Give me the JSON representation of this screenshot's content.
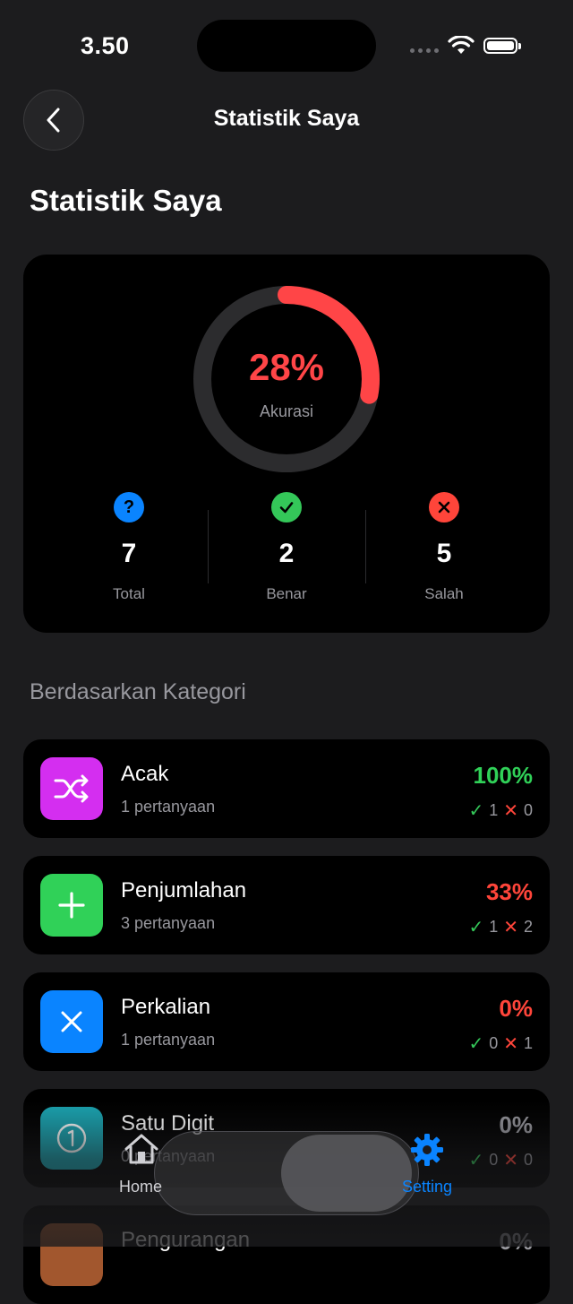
{
  "status_bar": {
    "time": "3.50"
  },
  "nav": {
    "title": "Statistik Saya"
  },
  "page": {
    "title": "Statistik Saya"
  },
  "summary": {
    "accuracy_percent": "28%",
    "accuracy_value": 0.28,
    "accuracy_label": "Akurasi",
    "total": {
      "value": "7",
      "label": "Total",
      "icon": "question-icon",
      "color": "#0a84ff"
    },
    "correct": {
      "value": "2",
      "label": "Benar",
      "icon": "check-icon",
      "color": "#34c759"
    },
    "wrong": {
      "value": "5",
      "label": "Salah",
      "icon": "x-icon",
      "color": "#ff453a"
    }
  },
  "categories_title": "Berdasarkan Kategori",
  "categories": [
    {
      "name": "Acak",
      "count": "1 pertanyaan",
      "percent": "100%",
      "percent_color": "#30d158",
      "correct": "1",
      "wrong": "0",
      "icon": "shuffle-icon",
      "icon_bg": "#d42ef0"
    },
    {
      "name": "Penjumlahan",
      "count": "3 pertanyaan",
      "percent": "33%",
      "percent_color": "#ff453a",
      "correct": "1",
      "wrong": "2",
      "icon": "plus-icon",
      "icon_bg": "#30d158"
    },
    {
      "name": "Perkalian",
      "count": "1 pertanyaan",
      "percent": "0%",
      "percent_color": "#ff453a",
      "correct": "0",
      "wrong": "1",
      "icon": "multiply-icon",
      "icon_bg": "#0a84ff"
    },
    {
      "name": "Satu Digit",
      "count": "0 pertanyaan",
      "percent": "0%",
      "percent_color": "#98989e",
      "correct": "0",
      "wrong": "0",
      "icon": "one-circle-icon",
      "icon_bg": "#1aa3b0"
    },
    {
      "name": "Pengurangan",
      "count": "",
      "percent": "0%",
      "percent_color": "#98989e",
      "icon": "minus-icon",
      "icon_bg": "#a2572e"
    }
  ],
  "tabbar": {
    "home_label": "Home",
    "setting_label": "Setting",
    "active_color": "#0a84ff"
  }
}
